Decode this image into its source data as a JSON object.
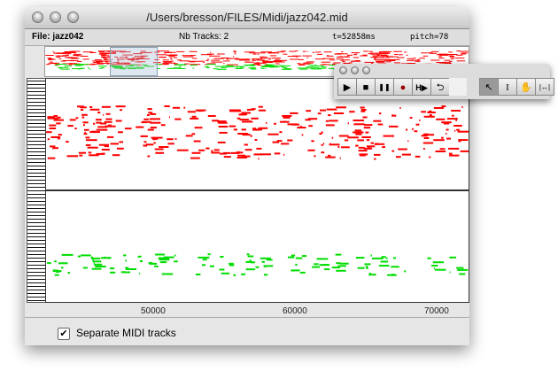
{
  "window": {
    "title": "/Users/bresson/FILES/Midi/jazz042.mid"
  },
  "info": {
    "file": "File: jazz042",
    "tracks": "Nb Tracks: 2",
    "time": "t=52858ms",
    "pitch": "pitch=78"
  },
  "axis": {
    "ticks": [
      "50000",
      "60000",
      "70000"
    ]
  },
  "bottom": {
    "checkbox_label": "Separate MIDI tracks",
    "checked": true,
    "check_glyph": "✔"
  },
  "palette": {
    "buttons": [
      {
        "name": "play",
        "glyph": "▶"
      },
      {
        "name": "stop",
        "glyph": "■"
      },
      {
        "name": "pause",
        "glyph": "❚❚"
      },
      {
        "name": "record",
        "glyph": "●"
      },
      {
        "name": "play-from",
        "glyph": "H▶"
      },
      {
        "name": "loop",
        "glyph": "⮌"
      }
    ],
    "tools": [
      {
        "name": "arrow",
        "glyph": "↖"
      },
      {
        "name": "text-cursor",
        "glyph": "I"
      },
      {
        "name": "hand",
        "glyph": "✋"
      },
      {
        "name": "stretch",
        "glyph": "|↔|"
      }
    ]
  },
  "colors": {
    "track1": "#ff0000",
    "track2": "#00dd00"
  }
}
